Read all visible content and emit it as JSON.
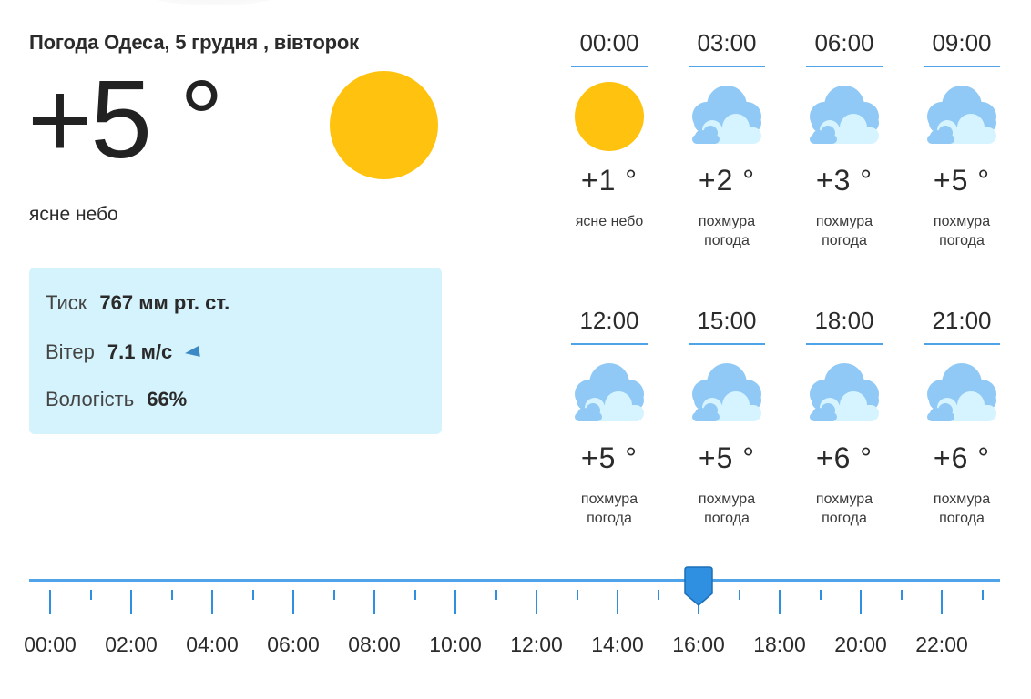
{
  "header": {
    "title": "Погода Одеса, 5 грудня , вівторок"
  },
  "current": {
    "temperature": "+5 °",
    "icon": "sun-icon",
    "description": "ясне небо"
  },
  "details": {
    "pressure_label": "Тиск",
    "pressure_value": "767 мм рт. ст.",
    "wind_label": "Вітер",
    "wind_value": "7.1 м/с",
    "wind_icon": "wind-direction-icon",
    "humidity_label": "Вологість",
    "humidity_value": "66%"
  },
  "forecast": [
    {
      "time": "00:00",
      "temp": "+1 °",
      "condition": "ясне небо",
      "icon": "sun-icon"
    },
    {
      "time": "03:00",
      "temp": "+2 °",
      "condition": "похмура погода",
      "icon": "cloud-icon"
    },
    {
      "time": "06:00",
      "temp": "+3 °",
      "condition": "похмура погода",
      "icon": "cloud-icon"
    },
    {
      "time": "09:00",
      "temp": "+5 °",
      "condition": "похмура погода",
      "icon": "cloud-icon"
    },
    {
      "time": "12:00",
      "temp": "+5 °",
      "condition": "похмура погода",
      "icon": "cloud-icon"
    },
    {
      "time": "15:00",
      "temp": "+5 °",
      "condition": "похмура погода",
      "icon": "cloud-icon"
    },
    {
      "time": "18:00",
      "temp": "+6 °",
      "condition": "похмура погода",
      "icon": "cloud-icon"
    },
    {
      "time": "21:00",
      "temp": "+6 °",
      "condition": "похмура погода",
      "icon": "cloud-icon"
    }
  ],
  "timeline": {
    "labels": [
      "00:00",
      "02:00",
      "04:00",
      "06:00",
      "08:00",
      "10:00",
      "12:00",
      "14:00",
      "16:00",
      "18:00",
      "20:00",
      "22:00"
    ],
    "selected_hour": 16
  },
  "colors": {
    "sun": "#ffc20e",
    "accent": "#2f90e2",
    "info_bg": "#d5f3fc",
    "cloud_back": "#90c9f5",
    "cloud_front": "#d6f4ff"
  }
}
